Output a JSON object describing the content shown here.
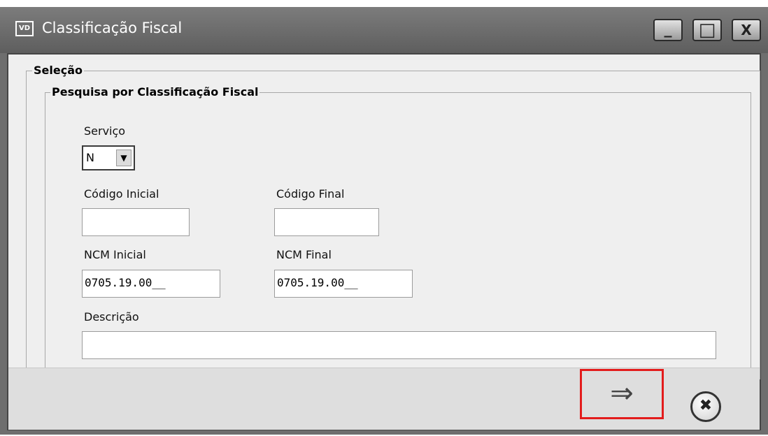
{
  "window": {
    "title": "Classificação Fiscal",
    "app_icon_text": "VD",
    "controls": {
      "minimize": "_",
      "maximize": "□",
      "close": "X"
    }
  },
  "selection": {
    "legend": "Seleção",
    "search": {
      "legend": "Pesquisa por Classificação Fiscal",
      "servico": {
        "label": "Serviço",
        "value": "N",
        "icon": "dropdown-arrow"
      },
      "codigo_inicial": {
        "label": "Código Inicial",
        "value": ""
      },
      "codigo_final": {
        "label": "Código Final",
        "value": ""
      },
      "ncm_inicial": {
        "label": "NCM Inicial",
        "value": "0705.19.00__"
      },
      "ncm_final": {
        "label": "NCM Final",
        "value": "0705.19.00__"
      },
      "descricao": {
        "label": "Descrição",
        "value": ""
      }
    }
  },
  "footer": {
    "next_button_glyph": "⇒",
    "cancel_button_glyph": "✖",
    "highlight_color": "#e31c1c"
  }
}
